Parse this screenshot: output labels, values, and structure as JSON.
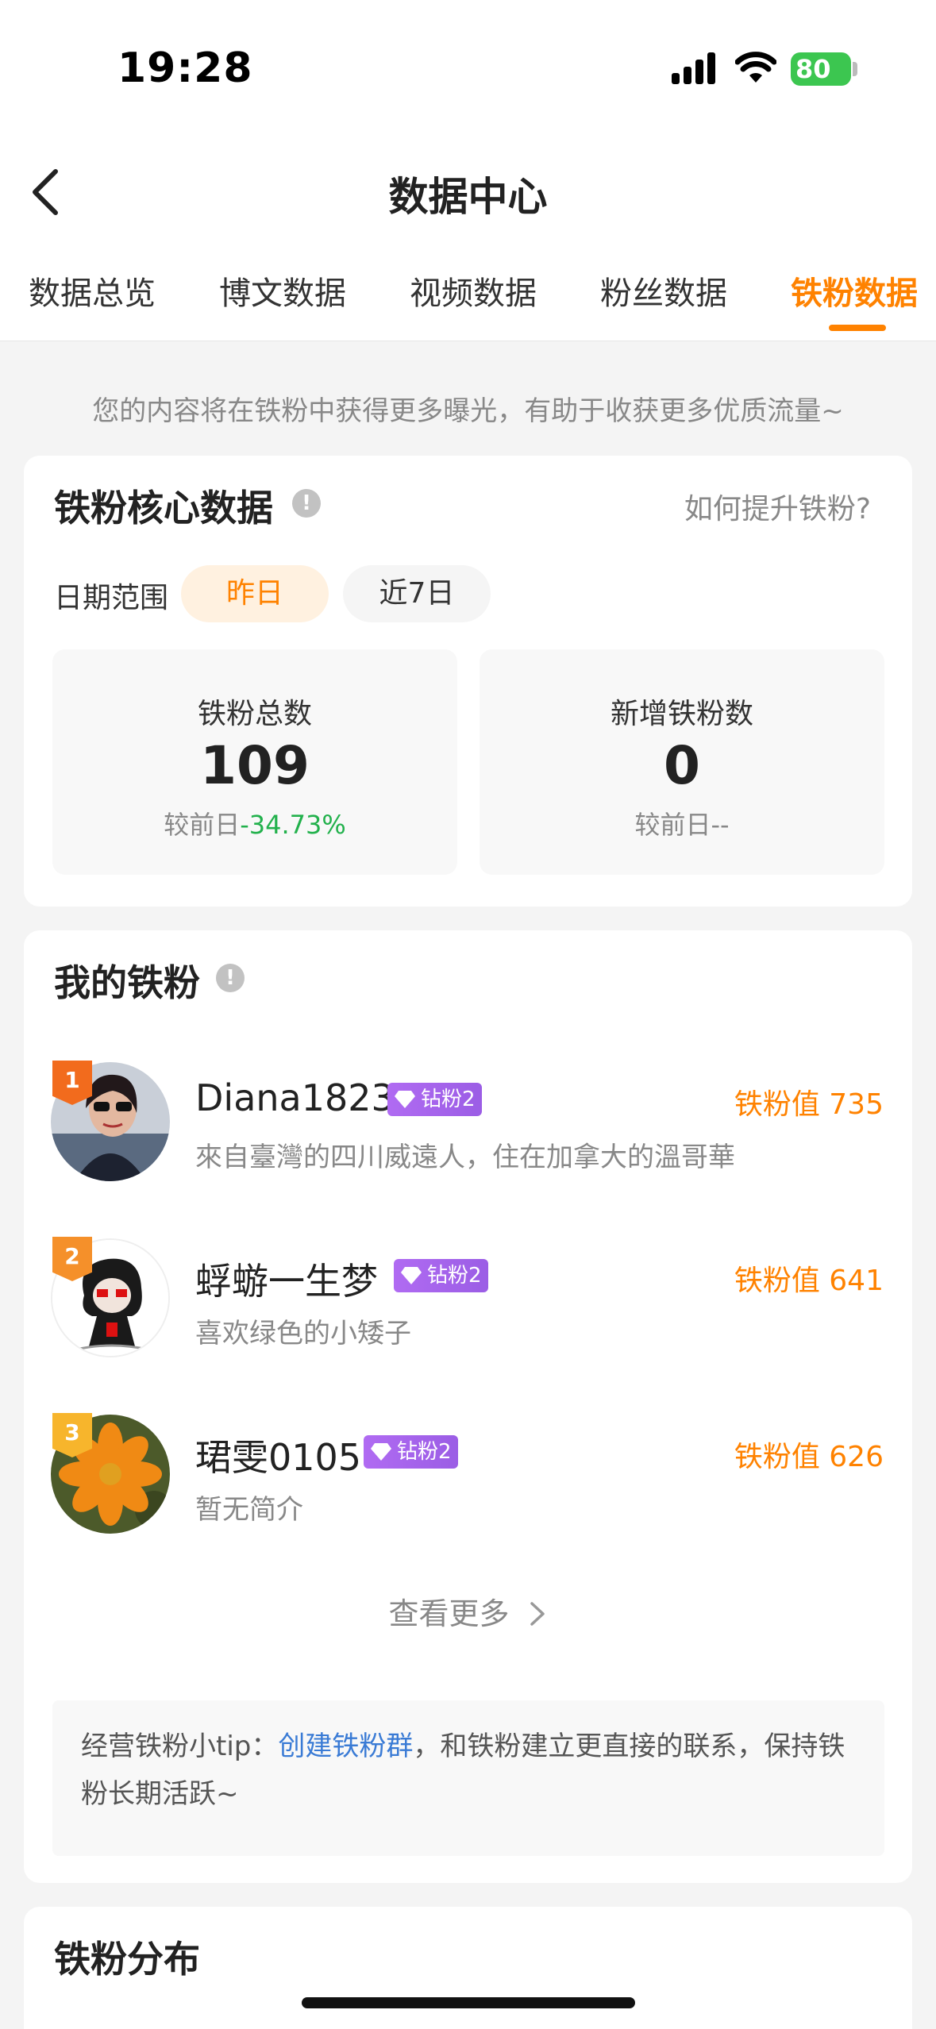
{
  "status": {
    "time": "19:28",
    "battery": "80"
  },
  "nav": {
    "title": "数据中心"
  },
  "tabs": [
    {
      "label": "数据总览"
    },
    {
      "label": "博文数据"
    },
    {
      "label": "视频数据"
    },
    {
      "label": "粉丝数据"
    },
    {
      "label": "铁粉数据",
      "active": true
    }
  ],
  "notice": "您的内容将在铁粉中获得更多曝光，有助于收获更多优质流量~",
  "core": {
    "title": "铁粉核心数据",
    "how_link": "如何提升铁粉?",
    "date_label": "日期范围",
    "chips": [
      "昨日",
      "近7日"
    ],
    "stats": [
      {
        "label": "铁粉总数",
        "value": "109",
        "compare_prefix": "较前日",
        "compare_value": "-34.73%"
      },
      {
        "label": "新增铁粉数",
        "value": "0",
        "compare_prefix": "较前日",
        "compare_value": "--"
      }
    ]
  },
  "my_fans": {
    "title": "我的铁粉",
    "fans": [
      {
        "rank": "1",
        "name": "Diana1823",
        "level": "钻粉2",
        "value": "铁粉值 735",
        "bio": "來自臺灣的四川威遠人，住在加拿大的溫哥華",
        "rank_color": "#f26b1d"
      },
      {
        "rank": "2",
        "name": "蜉蝣一生梦",
        "level": "钻粉2",
        "value": "铁粉值 641",
        "bio": "喜欢绿色的小矮子",
        "rank_color": "#f5902a"
      },
      {
        "rank": "3",
        "name": "珺雯0105",
        "level": "钻粉2",
        "value": "铁粉值 626",
        "bio": "暂无简介",
        "rank_color": "#f7b52c"
      }
    ],
    "see_more": "查看更多",
    "tip_prefix": "经营铁粉小tip：",
    "tip_link": "创建铁粉群",
    "tip_suffix": "，和铁粉建立更直接的联系，保持铁粉长期活跃~"
  },
  "distribution": {
    "title": "铁粉分布"
  },
  "colors": {
    "accent": "#ff8200",
    "positive": "#22b14c",
    "link": "#3a7bd5"
  }
}
